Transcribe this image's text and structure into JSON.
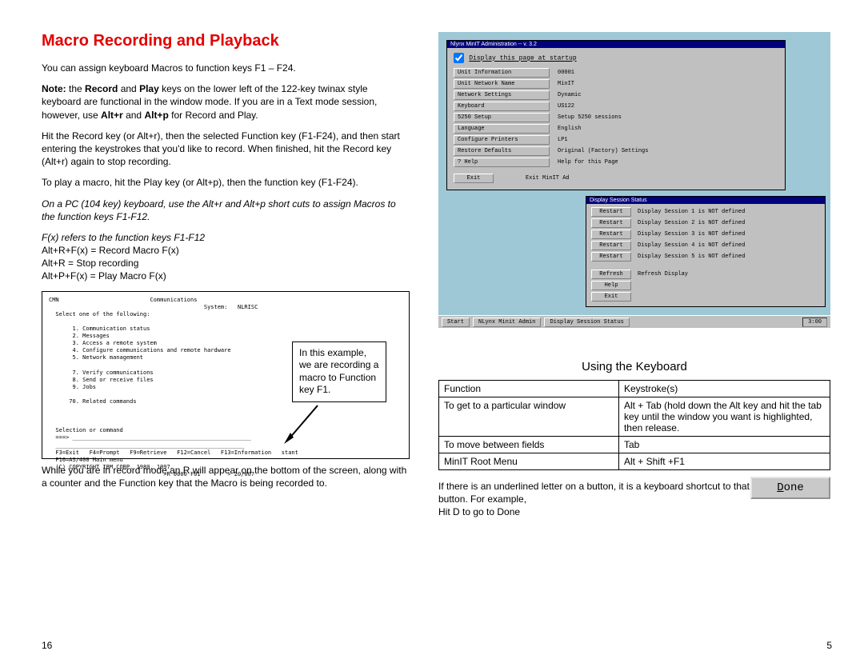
{
  "left": {
    "heading": "Macro Recording and Playback",
    "p1": "You can assign keyboard Macros to function keys F1 – F24.",
    "note_label": "Note:",
    "note_part_a": "  the ",
    "note_b1": "Record",
    "note_mid": " and ",
    "note_b2": "Play",
    "note_part_b": " keys on the lower left of the 122-key twinax style keyboard are functional in the window mode.  If you are in a Text mode session, however, use ",
    "note_b3": "Alt+r",
    "note_and": " and ",
    "note_b4": "Alt+p",
    "note_tail": " for Record and Play.",
    "p3": "Hit the Record key (or Alt+r), then the selected Function key (F1-F24), and then start entering the keystrokes that you'd like to record.  When finished, hit the Record key (Alt+r) again to stop recording.",
    "p4": "To play a macro, hit the Play key (or Alt+p), then the function key (F1-F24).",
    "p5_italic": "On a PC (104 key) keyboard, use the Alt+r and Alt+p short cuts to assign Macros to the function keys F1-F12.",
    "p6_italic": "F(x) refers to the function keys F1-F12",
    "p7a": "Alt+R+F(x) = Record Macro F(x)",
    "p7b": "Alt+R = Stop recording",
    "p7c": "Alt+P+F(x) = Play Macro F(x)",
    "terminal": "CMN                           Communications\n                                              System:   NLRISC\n  Select one of the following:\n\n       1. Communication status\n       2. Messages\n       3. Access a remote system\n       4. Configure communications and remote hardware\n       5. Network management\n\n       7. Verify communications\n       8. Send or receive files\n       9. Jobs\n\n      70. Related commands\n\n\n\n  Selection or command\n  ===> _____________________________________________________\n  ________________________________________________________\n  F3=Exit   F4=Prompt   F9=Retrieve   F12=Cancel   F13=Information   stant\n  F16=AS/400 Main menu\n  (C) COPYRIGHT IBM CORP. 1980, 1997.\n                                  >R 0000 F01        > 20/007",
    "callout": "In this example, we are recording a macro to Function key F1.",
    "p8": "While you are in record mode an R will appear on the bottom of the screen, along with a counter and the Function key that the Macro is being recorded to."
  },
  "admin": {
    "title": "Nlynx MinIT Administration -- v. 3.2",
    "startup": "Display this page at startup",
    "menu": [
      "Unit Information",
      "Unit Network Name",
      "Network Settings",
      "Keyboard",
      "5250 Setup",
      "Language",
      "Configure Printers",
      "Restore Defaults",
      "? Help"
    ],
    "vals": [
      "00001",
      "MinIT",
      "",
      "Dynamic",
      "US122",
      "Setup 5250 sessions",
      "English",
      "LP1",
      "Original (Factory) Settings",
      "Help for this Page"
    ],
    "exit": "Exit",
    "exit_label": "Exit MinIT Ad"
  },
  "status": {
    "title": "Display Session Status",
    "rows": [
      {
        "btn": "Restart",
        "txt": "Display Session 1 is NOT defined"
      },
      {
        "btn": "Restart",
        "txt": "Display Session 2 is NOT defined"
      },
      {
        "btn": "Restart",
        "txt": "Display Session 3 is NOT defined"
      },
      {
        "btn": "Restart",
        "txt": "Display Session 4 is NOT defined"
      },
      {
        "btn": "Restart",
        "txt": "Display Session 5 is NOT defined"
      }
    ],
    "refresh_btn": "Refresh",
    "refresh_txt": "Refresh Display",
    "help": "Help",
    "exit": "Exit"
  },
  "taskbar": {
    "start": "Start",
    "b1": "NLynx Minit Admin",
    "b2": "Display Session Status",
    "clock": "3:00"
  },
  "kbd": {
    "title": "Using the Keyboard",
    "h1": "Function",
    "h2": "Keystroke(s)",
    "rows": [
      {
        "f": "To get to a particular window",
        "k": "Alt + Tab (hold down the Alt key and hit the tab key until the window you want is highlighted, then release."
      },
      {
        "f": "To move between fields",
        "k": "Tab"
      },
      {
        "f": "MinIT Root Menu",
        "k": "Alt + Shift +F1"
      }
    ],
    "note1": "If there is an underlined letter on a button, it is a keyboard shortcut to that button. For example,",
    "note2": "Hit D to go to Done",
    "done_u": "D",
    "done_rest": "one"
  },
  "pages": {
    "left": "16",
    "right": "5"
  }
}
